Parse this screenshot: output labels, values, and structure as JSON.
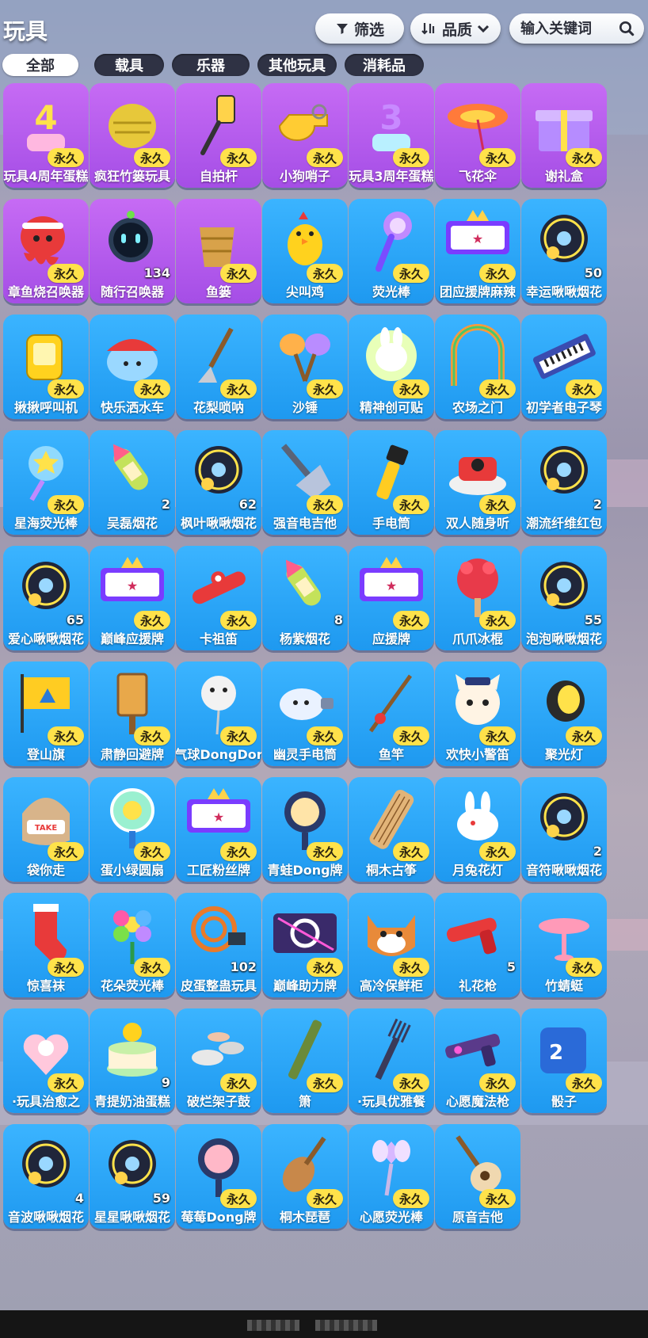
{
  "page": {
    "title": "玩具"
  },
  "toolbar": {
    "filter_label": "筛选",
    "quality_label": "品质",
    "search_placeholder": "输入关键词"
  },
  "tabs": [
    {
      "label": "全部",
      "active": true
    },
    {
      "label": "载具",
      "active": false
    },
    {
      "label": "乐器",
      "active": false
    },
    {
      "label": "其他玩具",
      "active": false
    },
    {
      "label": "消耗品",
      "active": false
    }
  ],
  "items": [
    {
      "name": "玩具4周年蛋糕",
      "badge": "永久",
      "count": "",
      "color": "purple",
      "icon": "anniversary-cake-4-icon"
    },
    {
      "name": "疯狂竹篓玩具",
      "badge": "永久",
      "count": "",
      "color": "purple",
      "icon": "basket-icon"
    },
    {
      "name": "自拍杆",
      "badge": "永久",
      "count": "",
      "color": "purple",
      "icon": "selfie-stick-icon"
    },
    {
      "name": "小狗哨子",
      "badge": "永久",
      "count": "",
      "color": "purple",
      "icon": "whistle-icon"
    },
    {
      "name": "玩具3周年蛋糕",
      "badge": "永久",
      "count": "",
      "color": "purple",
      "icon": "anniversary-cake-3-icon"
    },
    {
      "name": "飞花伞",
      "badge": "永久",
      "count": "",
      "color": "purple",
      "icon": "umbrella-icon"
    },
    {
      "name": "谢礼盒",
      "badge": "永久",
      "count": "",
      "color": "purple",
      "icon": "gift-box-icon"
    },
    {
      "name": "章鱼烧召唤器",
      "badge": "永久",
      "count": "",
      "color": "purple",
      "icon": "octopus-icon"
    },
    {
      "name": "随行召唤器",
      "badge": "",
      "count": "134",
      "color": "purple",
      "icon": "robot-icon"
    },
    {
      "name": "鱼篓",
      "badge": "永久",
      "count": "",
      "color": "purple",
      "icon": "fish-basket-icon"
    },
    {
      "name": "尖叫鸡",
      "badge": "永久",
      "count": "",
      "color": "blue",
      "icon": "chicken-icon"
    },
    {
      "name": "荧光棒",
      "badge": "永久",
      "count": "",
      "color": "blue",
      "icon": "glow-stick-icon"
    },
    {
      "name": "团应援牌麻辣",
      "badge": "永久",
      "count": "",
      "color": "blue",
      "icon": "cheer-sign-icon"
    },
    {
      "name": "幸运啾啾烟花",
      "badge": "",
      "count": "50",
      "color": "blue",
      "icon": "firework-icon"
    },
    {
      "name": "揪揪呼叫机",
      "badge": "永久",
      "count": "",
      "color": "blue",
      "icon": "pager-icon"
    },
    {
      "name": "快乐洒水车",
      "badge": "永久",
      "count": "",
      "color": "blue",
      "icon": "sprinkler-icon"
    },
    {
      "name": "花梨唢呐",
      "badge": "永久",
      "count": "",
      "color": "blue",
      "icon": "suona-icon"
    },
    {
      "name": "沙锤",
      "badge": "永久",
      "count": "",
      "color": "blue",
      "icon": "maracas-icon"
    },
    {
      "name": "精神创可贴",
      "badge": "永久",
      "count": "",
      "color": "blue",
      "icon": "bandage-icon"
    },
    {
      "name": "农场之门",
      "badge": "永久",
      "count": "",
      "color": "blue",
      "icon": "gate-icon"
    },
    {
      "name": "初学者电子琴",
      "badge": "永久",
      "count": "",
      "color": "blue",
      "icon": "keyboard-icon"
    },
    {
      "name": "星海荧光棒",
      "badge": "永久",
      "count": "",
      "color": "blue",
      "icon": "star-wand-icon"
    },
    {
      "name": "吴磊烟花",
      "badge": "",
      "count": "2",
      "color": "blue",
      "icon": "rocket-icon"
    },
    {
      "name": "枫叶啾啾烟花",
      "badge": "",
      "count": "62",
      "color": "blue",
      "icon": "firework-icon"
    },
    {
      "name": "强音电吉他",
      "badge": "永久",
      "count": "",
      "color": "blue",
      "icon": "electric-guitar-icon"
    },
    {
      "name": "手电筒",
      "badge": "永久",
      "count": "",
      "color": "blue",
      "icon": "flashlight-icon"
    },
    {
      "name": "双人随身听",
      "badge": "永久",
      "count": "",
      "color": "blue",
      "icon": "music-player-icon"
    },
    {
      "name": "潮流纤维红包",
      "badge": "",
      "count": "2",
      "color": "blue",
      "icon": "firework-icon"
    },
    {
      "name": "爱心啾啾烟花",
      "badge": "",
      "count": "65",
      "color": "blue",
      "icon": "firework-icon"
    },
    {
      "name": "巅峰应援牌",
      "badge": "永久",
      "count": "",
      "color": "blue",
      "icon": "cheer-sign-icon"
    },
    {
      "name": "卡祖笛",
      "badge": "永久",
      "count": "",
      "color": "blue",
      "icon": "kazoo-icon"
    },
    {
      "name": "杨紫烟花",
      "badge": "",
      "count": "8",
      "color": "blue",
      "icon": "rocket-icon"
    },
    {
      "name": "应援牌",
      "badge": "永久",
      "count": "",
      "color": "blue",
      "icon": "cheer-sign-icon"
    },
    {
      "name": "爪爪冰棍",
      "badge": "永久",
      "count": "",
      "color": "blue",
      "icon": "popsicle-icon"
    },
    {
      "name": "泡泡啾啾烟花",
      "badge": "",
      "count": "55",
      "color": "blue",
      "icon": "firework-icon"
    },
    {
      "name": "登山旗",
      "badge": "永久",
      "count": "",
      "color": "blue",
      "icon": "flag-icon"
    },
    {
      "name": "肃静回避牌",
      "badge": "永久",
      "count": "",
      "color": "blue",
      "icon": "sign-board-icon"
    },
    {
      "name": "气球DongDor",
      "badge": "永久",
      "count": "",
      "color": "blue",
      "icon": "balloon-icon"
    },
    {
      "name": "幽灵手电筒",
      "badge": "永久",
      "count": "",
      "color": "blue",
      "icon": "ghost-flashlight-icon"
    },
    {
      "name": "鱼竿",
      "badge": "永久",
      "count": "",
      "color": "blue",
      "icon": "fishing-rod-icon"
    },
    {
      "name": "欢快小警笛",
      "badge": "永久",
      "count": "",
      "color": "blue",
      "icon": "police-cat-icon"
    },
    {
      "name": "聚光灯",
      "badge": "永久",
      "count": "",
      "color": "blue",
      "icon": "spotlight-icon"
    },
    {
      "name": "袋你走",
      "badge": "永久",
      "count": "",
      "color": "blue",
      "icon": "sack-icon"
    },
    {
      "name": "蛋小绿圆扇",
      "badge": "永久",
      "count": "",
      "color": "blue",
      "icon": "fan-icon"
    },
    {
      "name": "工匠粉丝牌",
      "badge": "永久",
      "count": "",
      "color": "blue",
      "icon": "cheer-sign-icon"
    },
    {
      "name": "青蛙Dong牌",
      "badge": "永久",
      "count": "",
      "color": "blue",
      "icon": "frog-sign-icon"
    },
    {
      "name": "桐木古筝",
      "badge": "永久",
      "count": "",
      "color": "blue",
      "icon": "guzheng-icon"
    },
    {
      "name": "月兔花灯",
      "badge": "永久",
      "count": "",
      "color": "blue",
      "icon": "rabbit-lantern-icon"
    },
    {
      "name": "音符啾啾烟花",
      "badge": "",
      "count": "2",
      "color": "blue",
      "icon": "firework-icon"
    },
    {
      "name": "惊喜袜",
      "badge": "永久",
      "count": "",
      "color": "blue",
      "icon": "stocking-icon"
    },
    {
      "name": "花朵荧光棒",
      "badge": "永久",
      "count": "",
      "color": "blue",
      "icon": "flower-icon"
    },
    {
      "name": "皮蛋整蛊玩具",
      "badge": "",
      "count": "102",
      "color": "blue",
      "icon": "prank-toy-icon"
    },
    {
      "name": "巅峰助力牌",
      "badge": "永久",
      "count": "",
      "color": "blue",
      "icon": "power-sign-icon"
    },
    {
      "name": "高冷保鲜柜",
      "badge": "永久",
      "count": "",
      "color": "blue",
      "icon": "fox-icon"
    },
    {
      "name": "礼花枪",
      "badge": "",
      "count": "5",
      "color": "blue",
      "icon": "confetti-gun-icon"
    },
    {
      "name": "竹蜻蜓",
      "badge": "永久",
      "count": "",
      "color": "blue",
      "icon": "bamboo-copter-icon"
    },
    {
      "name": "·玩具治愈之",
      "badge": "永久",
      "count": "",
      "color": "blue",
      "icon": "heart-bow-icon"
    },
    {
      "name": "青提奶油蛋糕",
      "badge": "",
      "count": "9",
      "color": "blue",
      "icon": "cake-icon"
    },
    {
      "name": "破烂架子鼓",
      "badge": "永久",
      "count": "",
      "color": "blue",
      "icon": "drum-icon"
    },
    {
      "name": "箫",
      "badge": "永久",
      "count": "",
      "color": "blue",
      "icon": "flute-icon"
    },
    {
      "name": "·玩具优雅餐",
      "badge": "永久",
      "count": "",
      "color": "blue",
      "icon": "fork-icon"
    },
    {
      "name": "心愿魔法枪",
      "badge": "永久",
      "count": "",
      "color": "blue",
      "icon": "magic-gun-icon"
    },
    {
      "name": "骰子",
      "badge": "永久",
      "count": "",
      "color": "blue",
      "icon": "dice-icon"
    },
    {
      "name": "音波啾啾烟花",
      "badge": "",
      "count": "4",
      "color": "blue",
      "icon": "firework-icon"
    },
    {
      "name": "星星啾啾烟花",
      "badge": "",
      "count": "59",
      "color": "blue",
      "icon": "firework-icon"
    },
    {
      "name": "莓莓Dong牌",
      "badge": "永久",
      "count": "",
      "color": "blue",
      "icon": "berry-sign-icon"
    },
    {
      "name": "桐木琵琶",
      "badge": "永久",
      "count": "",
      "color": "blue",
      "icon": "pipa-icon"
    },
    {
      "name": "心愿荧光棒",
      "badge": "永久",
      "count": "",
      "color": "blue",
      "icon": "fairy-wand-icon"
    },
    {
      "name": "原音吉他",
      "badge": "永久",
      "count": "",
      "color": "blue",
      "icon": "acoustic-guitar-icon"
    }
  ],
  "colors": {
    "card_blue": "#1e99f0",
    "card_purple": "#a54ee6",
    "badge_yellow": "#ffe24a"
  }
}
